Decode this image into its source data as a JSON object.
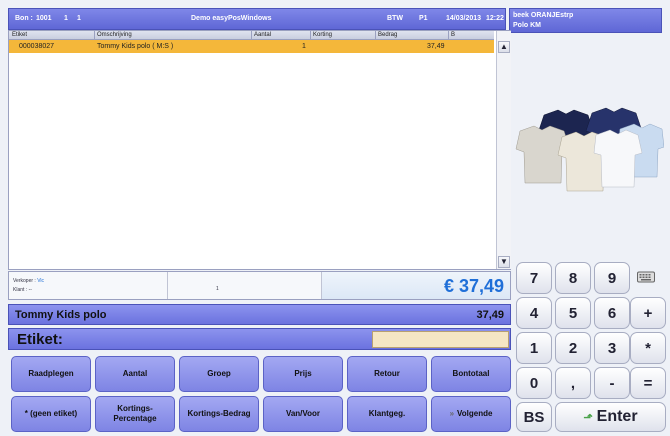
{
  "header": {
    "bon_label": "Bon :",
    "bon_number": "1001",
    "bon_a": "1",
    "bon_b": "1",
    "title": "Demo easyPosWindows",
    "btw_label": "BTW",
    "btw_value": "P1",
    "date": "14/03/2013",
    "time": "12:22"
  },
  "info": {
    "line1": "beek  ORANJEstrp",
    "line2": "Polo KM"
  },
  "table": {
    "columns": [
      "Etiket",
      "Omschrijving",
      "Aantal",
      "Korting",
      "Bedrag",
      "B"
    ],
    "rows": [
      {
        "etiket": "000038027",
        "omschrijving": "Tommy Kids polo  ( M:S )",
        "aantal": "1",
        "korting": "",
        "bedrag": "37,49",
        "b": ""
      }
    ]
  },
  "footer": {
    "verkoper_label": "Verkoper  :",
    "verkoper_value": "Vic",
    "klant_label": "Klant",
    "klant_value": ": --",
    "count": "1",
    "total": "€ 37,49"
  },
  "product": {
    "name": "Tommy Kids polo",
    "price": "37,49"
  },
  "etiket": {
    "label": "Etiket:",
    "value": ""
  },
  "function_buttons": {
    "raadplegen": "Raadplegen",
    "aantal": "Aantal",
    "groep": "Groep",
    "prijs": "Prijs",
    "retour": "Retour",
    "bontotaal": "Bontotaal",
    "geen_etiket": "* (geen etiket)",
    "kortings_percentage": "Kortings-Percentage",
    "kortings_bedrag": "Kortings-Bedrag",
    "van_voor": "Van/Voor",
    "klantgeg": "Klantgeg.",
    "volgende": "Volgende"
  },
  "keypad": {
    "k7": "7",
    "k8": "8",
    "k9": "9",
    "k4": "4",
    "k5": "5",
    "k6": "6",
    "plus": "+",
    "k1": "1",
    "k2": "2",
    "k3": "3",
    "mul": "*",
    "k0": "0",
    "comma": ",",
    "minus": "-",
    "eq": "=",
    "bs": "BS",
    "enter": "Enter"
  },
  "colors": {
    "header_blue": "#6b72df",
    "selected_row": "#f4b73a",
    "total_blue": "#1f6fd8"
  }
}
